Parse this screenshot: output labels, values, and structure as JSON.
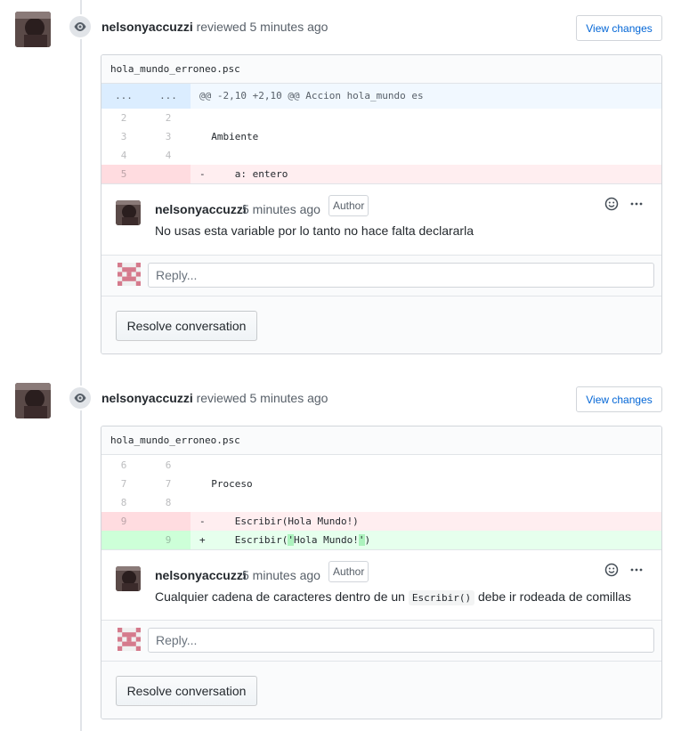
{
  "reviews": [
    {
      "header": {
        "author": "nelsonyaccuzzi",
        "action": "reviewed 5 minutes ago",
        "view_changes": "View changes"
      },
      "file": "hola_mundo_erroneo.psc",
      "hunk": {
        "left": "...",
        "right": "...",
        "text": "@@ -2,10 +2,10 @@ Accion hola_mundo es"
      },
      "lines": [
        {
          "old": "2",
          "new": "2",
          "text": "",
          "type": "ctx"
        },
        {
          "old": "3",
          "new": "3",
          "text": "  Ambiente",
          "type": "ctx"
        },
        {
          "old": "4",
          "new": "4",
          "text": "",
          "type": "ctx"
        },
        {
          "old": "5",
          "new": "",
          "text": "-     a: entero",
          "type": "del"
        }
      ],
      "comment": {
        "author": "nelsonyaccuzzi",
        "time": "5 minutes ago",
        "badge": "Author",
        "body": "No usas esta variable por lo tanto no hace falta declararla"
      },
      "reply_placeholder": "Reply...",
      "resolve": "Resolve conversation"
    },
    {
      "header": {
        "author": "nelsonyaccuzzi",
        "action": "reviewed 5 minutes ago",
        "view_changes": "View changes"
      },
      "file": "hola_mundo_erroneo.psc",
      "lines": [
        {
          "old": "6",
          "new": "6",
          "text": "",
          "type": "ctx"
        },
        {
          "old": "7",
          "new": "7",
          "text": "  Proceso",
          "type": "ctx"
        },
        {
          "old": "8",
          "new": "8",
          "text": "",
          "type": "ctx"
        },
        {
          "old": "9",
          "new": "",
          "text": "-     Escribir(Hola Mundo!)",
          "type": "del"
        },
        {
          "old": "",
          "new": "9",
          "text": "+     Escribir('Hola Mundo!')",
          "type": "add"
        }
      ],
      "comment": {
        "author": "nelsonyaccuzzi",
        "time": "5 minutes ago",
        "badge": "Author",
        "body_before": "Cualquier cadena de caracteres dentro de un",
        "body_code": "Escribir()",
        "body_after": "debe ir rodeada de comillas"
      },
      "reply_placeholder": "Reply...",
      "resolve": "Resolve conversation"
    }
  ],
  "icons": {
    "eye": "eye-icon",
    "smiley": "smiley-icon",
    "more": "kebab-horizontal-icon"
  }
}
